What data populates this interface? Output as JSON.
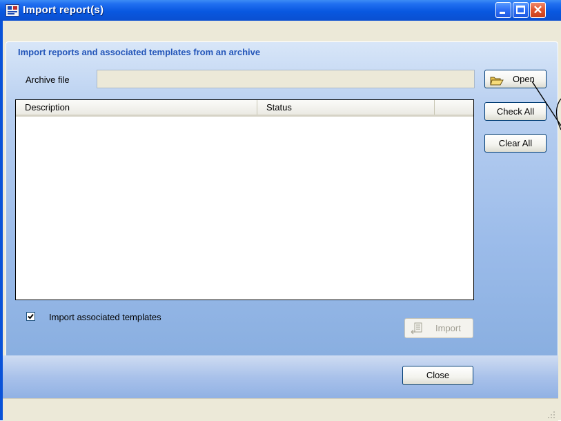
{
  "window": {
    "title": "Import report(s)",
    "buttons": {
      "minimize": "minimize",
      "maximize": "maximize",
      "close": "close"
    }
  },
  "panel": {
    "heading": "Import reports and associated templates from an archive",
    "archive_file_label": "Archive file",
    "archive_file_value": "",
    "open_button": "Open",
    "check_all_button": "Check All",
    "clear_all_button": "Clear All",
    "list": {
      "columns": [
        "Description",
        "Status"
      ],
      "rows": []
    },
    "import_templates_label": "Import associated templates",
    "import_templates_checked": true,
    "import_button": "Import",
    "import_enabled": false
  },
  "footer": {
    "close_button": "Close"
  },
  "colors": {
    "title_bar": "#0a58e0",
    "heading_text": "#2456b9",
    "panel_gradient_top": "#d8e6f8",
    "panel_gradient_bottom": "#87addf"
  },
  "icons": {
    "open": "folder-open-icon",
    "import": "import-icon",
    "app": "app-window-icon"
  }
}
